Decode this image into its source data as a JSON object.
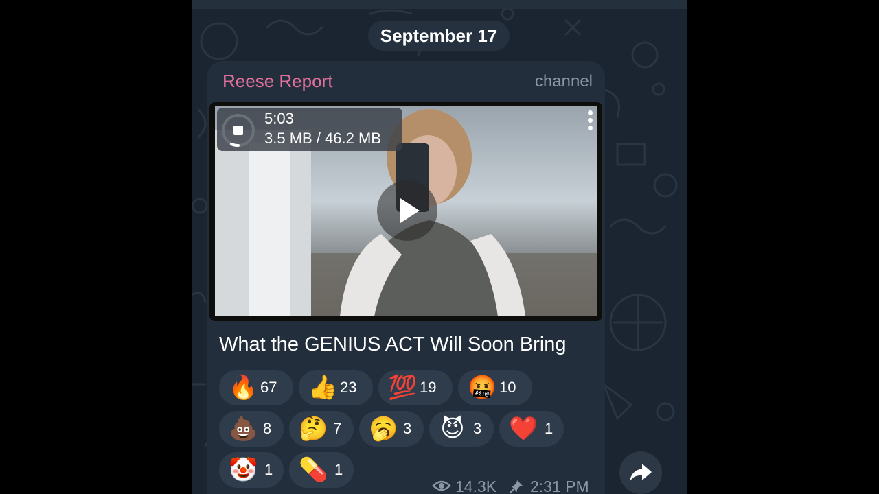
{
  "date_separator": "September 17",
  "post": {
    "channel_name": "Reese Report",
    "channel_label": "channel",
    "video": {
      "duration": "5:03",
      "download_progress": "3.5 MB / 46.2 MB",
      "progress_fraction": 0.076
    },
    "caption": "What the GENIUS ACT Will Soon Bring",
    "reactions": [
      {
        "emoji": "🔥",
        "count": "67"
      },
      {
        "emoji": "👍",
        "count": "23"
      },
      {
        "emoji": "💯",
        "count": "19"
      },
      {
        "emoji": "🤬",
        "count": "10"
      },
      {
        "emoji": "💩",
        "count": "8"
      },
      {
        "emoji": "🤔",
        "count": "7"
      },
      {
        "emoji": "🥱",
        "count": "3"
      },
      {
        "emoji": "😈",
        "count": "3"
      },
      {
        "emoji": "❤️",
        "count": "1"
      },
      {
        "emoji": "🤡",
        "count": "1"
      },
      {
        "emoji": "💊",
        "count": "1"
      }
    ],
    "views": "14.3K",
    "time": "2:31 PM"
  },
  "icons": {
    "play": "play-icon",
    "more": "more-vertical-icon",
    "views": "eye-icon",
    "pin": "pin-icon",
    "share": "share-arrow-icon",
    "download": "download-stop-icon"
  },
  "colors": {
    "channel_name": "#e0719e",
    "bubble": "#232e3c",
    "background": "#1b2531",
    "reaction_pill": "#2f3c4c",
    "meta_text": "#8a97a6"
  }
}
